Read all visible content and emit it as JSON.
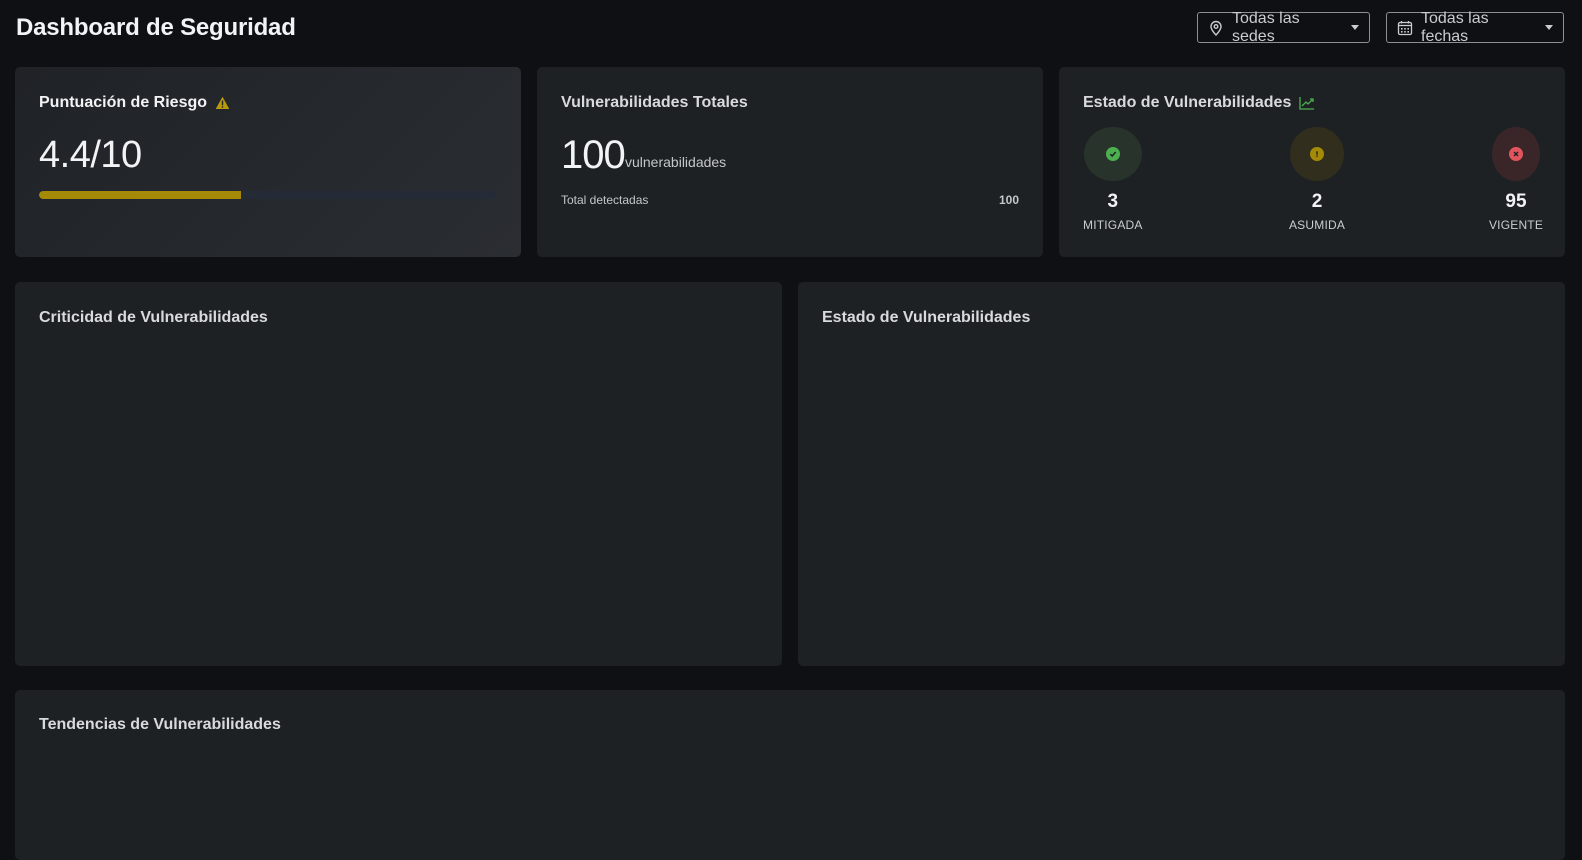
{
  "header": {
    "title": "Dashboard de Seguridad",
    "filter_sedes": "Todas las sedes",
    "filter_fechas": "Todas las fechas"
  },
  "risk": {
    "title": "Puntuación de Riesgo",
    "value": "4.4/10",
    "progress_percent": 44,
    "bar_color": "#a58a07"
  },
  "total": {
    "title": "Vulnerabilidades Totales",
    "count": "100",
    "unit": "vulnerabilidades",
    "sub_label": "Total detectadas",
    "sub_value": "100"
  },
  "status": {
    "title": "Estado de Vulnerabilidades",
    "items": [
      {
        "count": "3",
        "label": "MITIGADA",
        "icon": "check-circle-icon",
        "color": "#4caf50"
      },
      {
        "count": "2",
        "label": "ASUMIDA",
        "icon": "exclamation-circle-icon",
        "color": "#a58a07"
      },
      {
        "count": "95",
        "label": "VIGENTE",
        "icon": "x-circle-icon",
        "color": "#e0555c"
      }
    ]
  },
  "panels": {
    "criticidad_title": "Criticidad de Vulnerabilidades",
    "estado_title": "Estado de Vulnerabilidades",
    "tendencias_title": "Tendencias de Vulnerabilidades"
  }
}
